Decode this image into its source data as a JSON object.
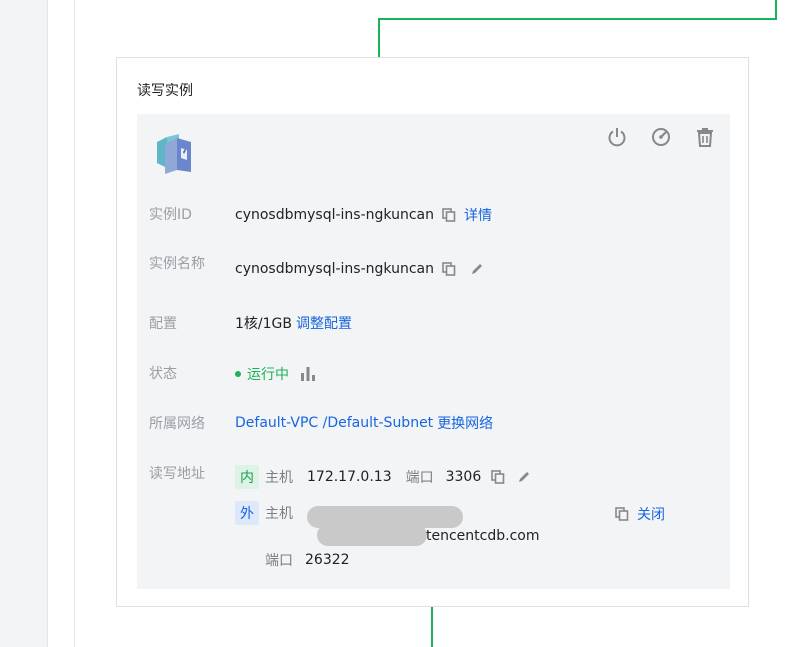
{
  "panel": {
    "title": "读写实例"
  },
  "actions": [
    {
      "name": "power-icon"
    },
    {
      "name": "speed-gauge-icon"
    },
    {
      "name": "trash-icon"
    }
  ],
  "fields": {
    "instance_id": {
      "label": "实例ID",
      "value": "cynosdbmysql-ins-ngkuncan",
      "link": "详情"
    },
    "instance_name": {
      "label": "实例名称",
      "value": "cynosdbmysql-ins-ngkuncan"
    },
    "config": {
      "label": "配置",
      "value": "1核/1GB",
      "link": "调整配置"
    },
    "status": {
      "label": "状态",
      "value": "运行中",
      "color": "#19b35a"
    },
    "network": {
      "label": "所属网络",
      "value": "Default-VPC /Default-Subnet",
      "link": "更换网络"
    },
    "address": {
      "label": "读写地址",
      "internal": {
        "tag": "内",
        "host_label": "主机",
        "host": "172.17.0.13",
        "port_label": "端口",
        "port": "3306"
      },
      "external": {
        "tag": "外",
        "host_label": "主机",
        "host_suffix": "tencentcdb.com",
        "port_label": "端口",
        "port": "26322",
        "close_link": "关闭"
      }
    }
  },
  "colors": {
    "link": "#1765e0",
    "success": "#19b35a",
    "topology_line": "#19b35a"
  }
}
